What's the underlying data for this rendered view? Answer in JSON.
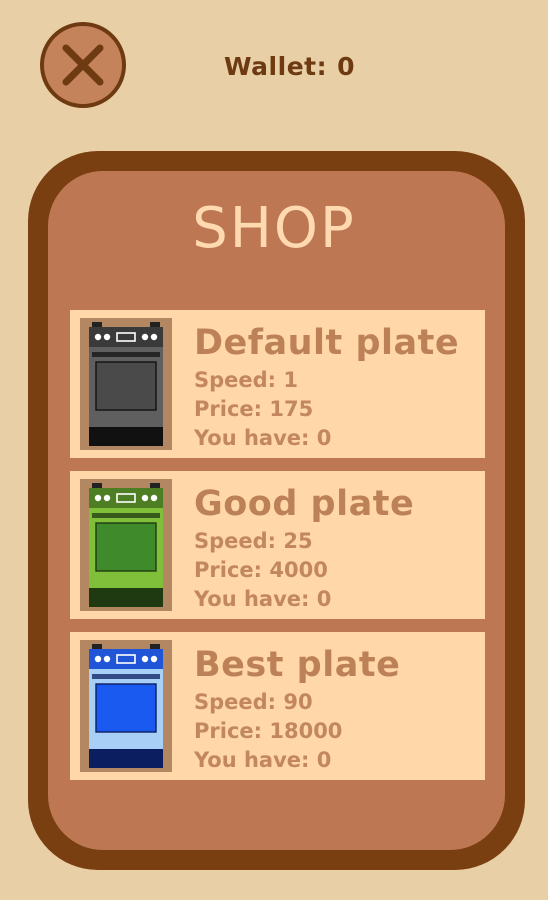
{
  "wallet": {
    "label": "Wallet:",
    "amount": "0"
  },
  "shop": {
    "title": "SHOP"
  },
  "items": [
    {
      "name": "Default plate",
      "speed_label": "Speed:",
      "speed": "1",
      "price_label": "Price:",
      "price": "175",
      "have_label": "You have:",
      "have": "0",
      "icon": "stove-gray-icon",
      "colors": {
        "body": "#5f5f5f",
        "door": "#4a4a4a",
        "top": "#3a3a3a",
        "base": "#111111"
      }
    },
    {
      "name": "Good plate",
      "speed_label": "Speed:",
      "speed": "25",
      "price_label": "Price:",
      "price": "4000",
      "have_label": "You have:",
      "have": "0",
      "icon": "stove-green-icon",
      "colors": {
        "body": "#7fbf3a",
        "door": "#3f8a2a",
        "top": "#4e7e23",
        "base": "#1f3a10"
      }
    },
    {
      "name": "Best plate",
      "speed_label": "Speed:",
      "speed": "90",
      "price_label": "Price:",
      "price": "18000",
      "have_label": "You have:",
      "have": "0",
      "icon": "stove-blue-icon",
      "colors": {
        "body": "#a8cff5",
        "door": "#1a5af0",
        "top": "#1f55d6",
        "base": "#0b1f60"
      }
    }
  ],
  "colors": {
    "background": "#e8cfa6",
    "panel_border": "#7a3f10",
    "panel": "#bd7853",
    "card": "#ffd7a8",
    "text": "#bd8158",
    "title": "#ffd9b0",
    "dark": "#6e3a12"
  }
}
